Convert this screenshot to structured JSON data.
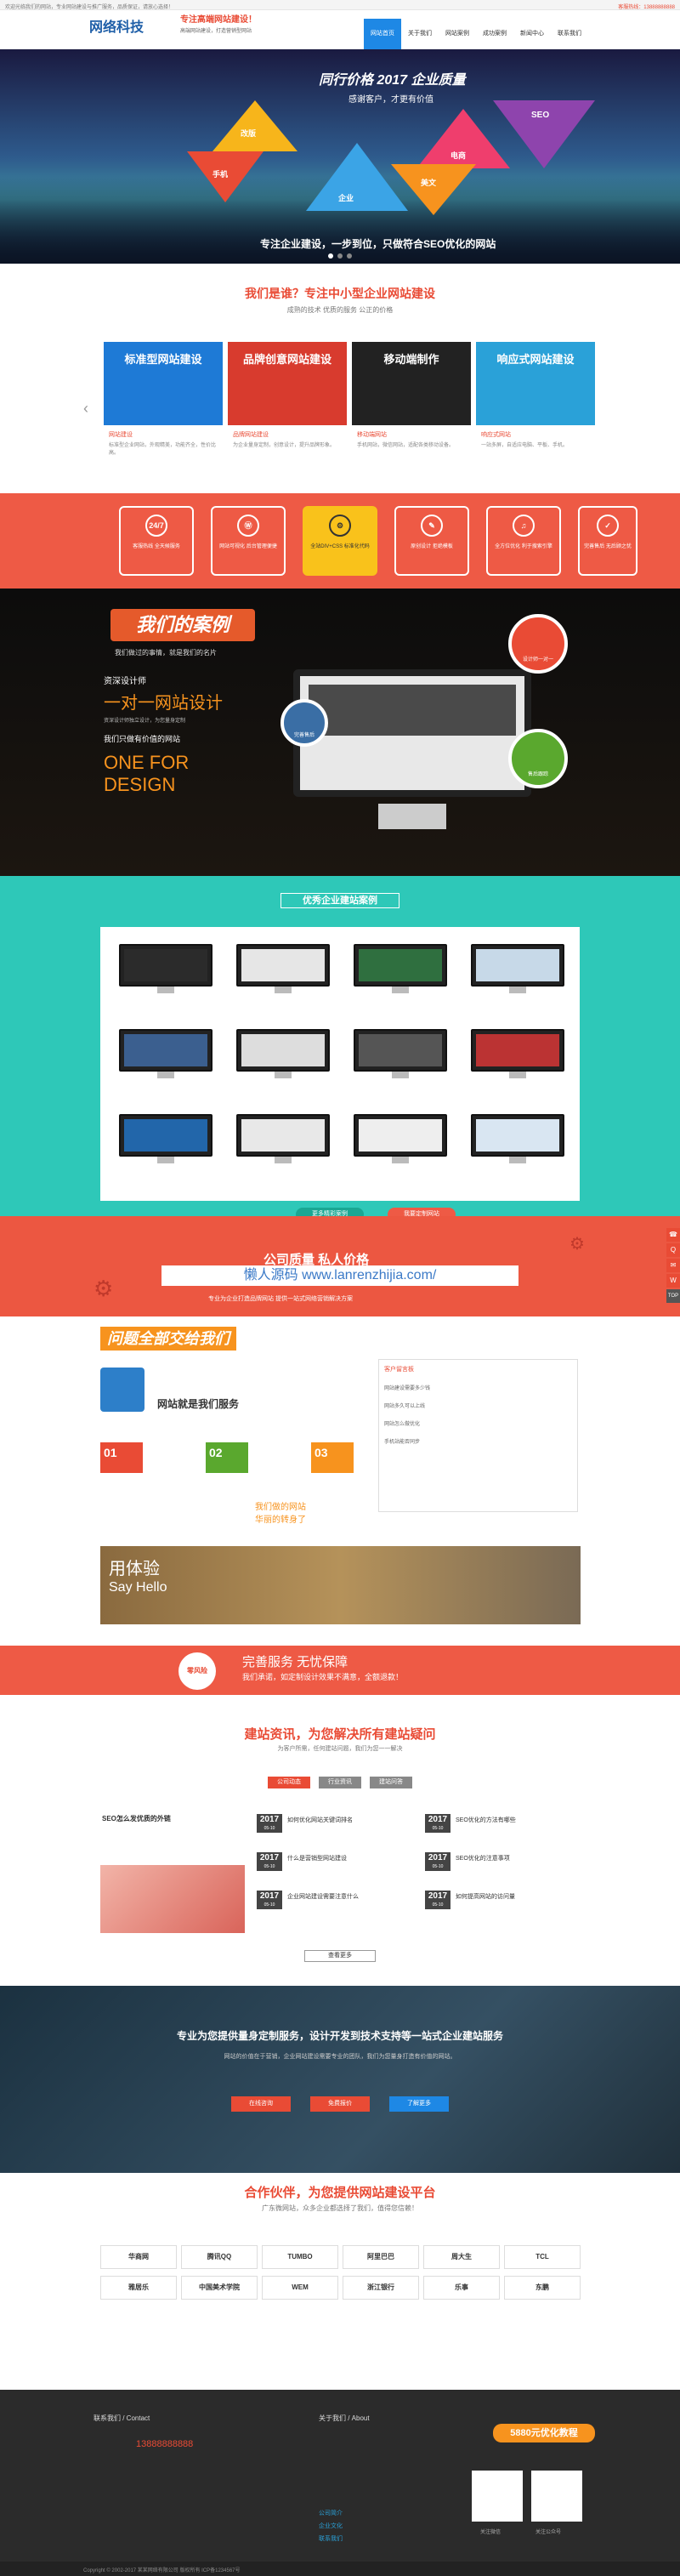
{
  "topbar": {
    "left": "欢迎光临我们的网站，专业网站建设与推广服务，品质保证，请放心选择！",
    "right": "客服热线：13888888888"
  },
  "header": {
    "logo": "网络科技",
    "slogan_main": "专注高端网站建设！",
    "slogan_sub": "高端网站建设，打造营销型网站"
  },
  "nav": [
    "网站首页",
    "关于我们",
    "网站案例",
    "成功案例",
    "新闻中心",
    "联系我们"
  ],
  "hero": {
    "line1": "同行价格 2017 企业质量",
    "line2": "感谢客户，才更有价值",
    "tiles": [
      "改版",
      "手机",
      "企业",
      "电商",
      "美文",
      "SEO"
    ],
    "bottom": "专注企业建设，一步到位，只做符合SEO优化的网站"
  },
  "whoweare": {
    "title": "我们是谁？专注中小型企业网站建设",
    "subtitle": "成熟的技术 优质的服务 公正的价格",
    "cards": [
      {
        "banner": "标准型网站建设",
        "cap": "网站建设",
        "txt": "标准型企业网站，外观精美，功能齐全，性价比高。"
      },
      {
        "banner": "品牌创意网站建设",
        "cap": "品牌网站建设",
        "txt": "为企业量身定制，创意设计，提升品牌形象。"
      },
      {
        "banner": "移动端制作",
        "cap": "移动端网站",
        "txt": "手机网站，微信网站，适配各类移动设备。"
      },
      {
        "banner": "响应式网站建设",
        "cap": "响应式网站",
        "txt": "一站多屏，自适应电脑、平板、手机。"
      }
    ]
  },
  "pain": [
    {
      "icon": "24/7",
      "t": "客服热线 全天候服务"
    },
    {
      "icon": "Ⓦ",
      "t": "网站可视化 后台管理便捷"
    },
    {
      "icon": "⚙",
      "t": "全站DIV+CSS 标准化代码"
    },
    {
      "icon": "✎",
      "t": "原创设计 拒绝模板"
    },
    {
      "icon": "♫",
      "t": "全方位优化 利于搜索引擎"
    },
    {
      "icon": "✓",
      "t": "完善售后 无后顾之忧"
    }
  ],
  "dark": {
    "banner": "我们的案例",
    "sub": "我们做过的事情，就是我们的名片",
    "d1": "资深设计师",
    "d2": "一对一网站设计",
    "d3": "资深设计师独立设计，为您量身定制",
    "d4": "我们只做有价值的网站",
    "d5": "ONE FOR DESIGN",
    "bubbles": [
      "设计师一对一",
      "完善售后",
      "售后跟踪"
    ]
  },
  "cases": {
    "title": "优秀企业建站案例",
    "btn1": "更多精彩案例",
    "btn2": "我要定制网站"
  },
  "price": {
    "t1": "公司质量 私人价格",
    "watermark": "懒人源码 www.lanrenzhijia.com/",
    "sub": "专业为企业打造品牌网站 提供一站式网络营销解决方案"
  },
  "qa": {
    "banner": "问题全部交给我们",
    "line": "网站就是我们服务",
    "nums": [
      "01",
      "02",
      "03"
    ],
    "c1": "我们做的网站",
    "c2": "华丽的转身了",
    "hello": "Say Hello",
    "hello_big": "用体验",
    "right_title": "客户留言板",
    "right_items": [
      "网站建设需要多少钱",
      "网站多久可以上线",
      "网站怎么做优化",
      "手机站能否同步"
    ]
  },
  "serv": {
    "t1": "完善服务 无忧保障",
    "t2": "我们承诺，如定制设计效果不满意，全额退款！"
  },
  "news": {
    "title": "建站资讯，为您解决所有建站疑问",
    "sub": "为客户所需，任何建站问题，我们为您一一解决",
    "tabs": [
      "公司动态",
      "行业资讯",
      "建站问答"
    ],
    "lead": "SEO怎么发优质的外链",
    "items": [
      {
        "y": "2017",
        "d": "05-10",
        "t": "如何优化网站关键词排名"
      },
      {
        "y": "2017",
        "d": "05-10",
        "t": "什么是营销型网站建设"
      },
      {
        "y": "2017",
        "d": "05-10",
        "t": "企业网站建设需要注意什么"
      },
      {
        "y": "2017",
        "d": "05-10",
        "t": "SEO优化的方法有哪些"
      },
      {
        "y": "2017",
        "d": "05-10",
        "t": "SEO优化的注意事项"
      },
      {
        "y": "2017",
        "d": "05-10",
        "t": "如何提高网站的访问量"
      }
    ],
    "more": "查看更多"
  },
  "custom": {
    "title": "专业为您提供量身定制服务，设计开发到技术支持等一站式企业建站服务",
    "desc": "网站的价值在于营销，企业网站建设需要专业的团队，我们为您量身打造有价值的网站。",
    "btns": [
      "在线咨询",
      "免费报价",
      "了解更多"
    ]
  },
  "partners": {
    "title": "合作伙伴，为您提供网站建设平台",
    "sub": "广东微网站，众多企业都选择了我们，值得您信赖！",
    "logos": [
      "华商网",
      "腾讯QQ",
      "TUMBO",
      "阿里巴巴",
      "周大生",
      "TCL",
      "雅居乐",
      "中国美术学院",
      "WEM",
      "浙江银行",
      "乐事",
      "东鹏"
    ]
  },
  "footer": {
    "contact_title": "联系我们 / Contact",
    "phone": "13888888888",
    "about_title": "关于我们 / About",
    "links": [
      "公司简介",
      "企业文化",
      "联系我们"
    ],
    "promo": "5880元优化教程",
    "qr1": "关注微信",
    "qr2": "关注公众号"
  },
  "copyright": "Copyright © 2002-2017 某某网络有限公司 版权所有 ICP备1234567号"
}
